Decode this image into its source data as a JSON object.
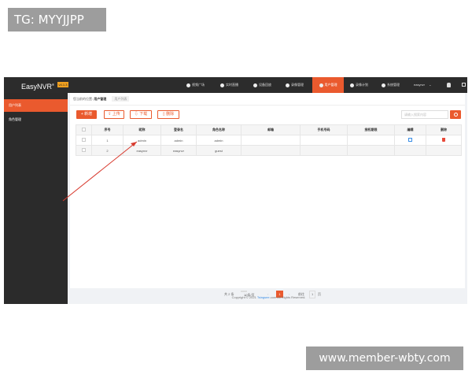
{
  "watermarks": {
    "top": "TG: MYYJJPP",
    "bottom": "www.member-wbty.com"
  },
  "topbar": {
    "logo": "EasyNVR",
    "logo_mark": "®",
    "version": "v4.1.3",
    "nav": [
      {
        "label": "视频广场",
        "icon": "play-icon"
      },
      {
        "label": "实时直播",
        "icon": "video-icon"
      },
      {
        "label": "设备回放",
        "icon": "replay-icon"
      },
      {
        "label": "录像管理",
        "icon": "record-icon"
      },
      {
        "label": "用户管理",
        "icon": "user-icon",
        "active": true
      },
      {
        "label": "录像计划",
        "icon": "clock-icon"
      },
      {
        "label": "系统管理",
        "icon": "settings-icon"
      }
    ],
    "user": "easynvr"
  },
  "sidebar": {
    "items": [
      {
        "label": "用户列表",
        "active": true
      },
      {
        "label": "角色管理"
      }
    ]
  },
  "breadcrumb": {
    "prefix": "您当前的位置:",
    "current": "用户管理",
    "tab": "用户列表"
  },
  "toolbar": {
    "add": "+ 新增",
    "upload": "上传",
    "download": "下载",
    "delete": "删除",
    "search_placeholder": "请输入搜索内容"
  },
  "table": {
    "headers": [
      "",
      "序号",
      "昵称",
      "登录名",
      "角色名称",
      "邮箱",
      "手机号码",
      "授权期限",
      "编辑",
      "删除"
    ],
    "rows": [
      {
        "index": "1",
        "nickname": "admin",
        "login": "admin",
        "role": "admin",
        "email": "",
        "phone": "",
        "expire": ""
      },
      {
        "index": "2",
        "nickname": "easynvr",
        "login": "easynvr",
        "role": "guest",
        "email": "",
        "phone": "",
        "expire": ""
      }
    ]
  },
  "pagination": {
    "total": "共 2 条",
    "size": "10条/页",
    "current": "1",
    "goto": "前往",
    "goto_value": "1",
    "unit": "页"
  },
  "footer": {
    "prefix": "Copyright © 2021 ",
    "brand": "Tsingsee",
    "suffix": ".com All Rights Reserved."
  },
  "colors": {
    "accent": "#ea5a2e",
    "topbar": "#2c2c2c",
    "sidebar": "#2b2b2b"
  }
}
